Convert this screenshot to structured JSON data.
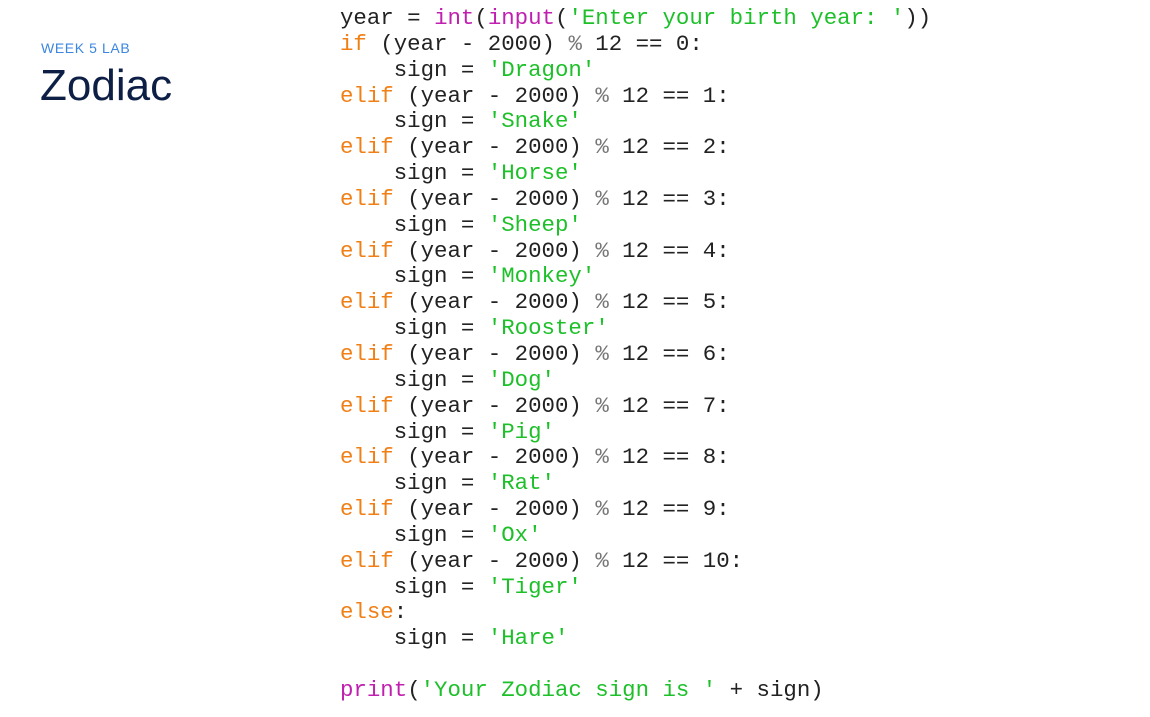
{
  "header": {
    "eyebrow": "WEEK 5 LAB",
    "title": "Zodiac"
  },
  "colors": {
    "eyebrow": "#3b86e0",
    "title": "#0d1f45",
    "keyword": "#f07f16",
    "builtin": "#c020b0",
    "string": "#1ec02a",
    "operator": "#777777",
    "text": "#222222"
  },
  "code": {
    "language": "python",
    "lines": [
      [
        {
          "t": "txt",
          "v": "year = "
        },
        {
          "t": "fn",
          "v": "int"
        },
        {
          "t": "txt",
          "v": "("
        },
        {
          "t": "fn",
          "v": "input"
        },
        {
          "t": "txt",
          "v": "("
        },
        {
          "t": "str",
          "v": "'Enter your birth year: '"
        },
        {
          "t": "txt",
          "v": "))"
        }
      ],
      [
        {
          "t": "kw",
          "v": "if"
        },
        {
          "t": "txt",
          "v": " (year - 2000) "
        },
        {
          "t": "op",
          "v": "%"
        },
        {
          "t": "txt",
          "v": " 12 == 0:"
        }
      ],
      [
        {
          "t": "txt",
          "v": "    sign = "
        },
        {
          "t": "str",
          "v": "'Dragon'"
        }
      ],
      [
        {
          "t": "kw",
          "v": "elif"
        },
        {
          "t": "txt",
          "v": " (year - 2000) "
        },
        {
          "t": "op",
          "v": "%"
        },
        {
          "t": "txt",
          "v": " 12 == 1:"
        }
      ],
      [
        {
          "t": "txt",
          "v": "    sign = "
        },
        {
          "t": "str",
          "v": "'Snake'"
        }
      ],
      [
        {
          "t": "kw",
          "v": "elif"
        },
        {
          "t": "txt",
          "v": " (year - 2000) "
        },
        {
          "t": "op",
          "v": "%"
        },
        {
          "t": "txt",
          "v": " 12 == 2:"
        }
      ],
      [
        {
          "t": "txt",
          "v": "    sign = "
        },
        {
          "t": "str",
          "v": "'Horse'"
        }
      ],
      [
        {
          "t": "kw",
          "v": "elif"
        },
        {
          "t": "txt",
          "v": " (year - 2000) "
        },
        {
          "t": "op",
          "v": "%"
        },
        {
          "t": "txt",
          "v": " 12 == 3:"
        }
      ],
      [
        {
          "t": "txt",
          "v": "    sign = "
        },
        {
          "t": "str",
          "v": "'Sheep'"
        }
      ],
      [
        {
          "t": "kw",
          "v": "elif"
        },
        {
          "t": "txt",
          "v": " (year - 2000) "
        },
        {
          "t": "op",
          "v": "%"
        },
        {
          "t": "txt",
          "v": " 12 == 4:"
        }
      ],
      [
        {
          "t": "txt",
          "v": "    sign = "
        },
        {
          "t": "str",
          "v": "'Monkey'"
        }
      ],
      [
        {
          "t": "kw",
          "v": "elif"
        },
        {
          "t": "txt",
          "v": " (year - 2000) "
        },
        {
          "t": "op",
          "v": "%"
        },
        {
          "t": "txt",
          "v": " 12 == 5:"
        }
      ],
      [
        {
          "t": "txt",
          "v": "    sign = "
        },
        {
          "t": "str",
          "v": "'Rooster'"
        }
      ],
      [
        {
          "t": "kw",
          "v": "elif"
        },
        {
          "t": "txt",
          "v": " (year - 2000) "
        },
        {
          "t": "op",
          "v": "%"
        },
        {
          "t": "txt",
          "v": " 12 == 6:"
        }
      ],
      [
        {
          "t": "txt",
          "v": "    sign = "
        },
        {
          "t": "str",
          "v": "'Dog'"
        }
      ],
      [
        {
          "t": "kw",
          "v": "elif"
        },
        {
          "t": "txt",
          "v": " (year - 2000) "
        },
        {
          "t": "op",
          "v": "%"
        },
        {
          "t": "txt",
          "v": " 12 == 7:"
        }
      ],
      [
        {
          "t": "txt",
          "v": "    sign = "
        },
        {
          "t": "str",
          "v": "'Pig'"
        }
      ],
      [
        {
          "t": "kw",
          "v": "elif"
        },
        {
          "t": "txt",
          "v": " (year - 2000) "
        },
        {
          "t": "op",
          "v": "%"
        },
        {
          "t": "txt",
          "v": " 12 == 8:"
        }
      ],
      [
        {
          "t": "txt",
          "v": "    sign = "
        },
        {
          "t": "str",
          "v": "'Rat'"
        }
      ],
      [
        {
          "t": "kw",
          "v": "elif"
        },
        {
          "t": "txt",
          "v": " (year - 2000) "
        },
        {
          "t": "op",
          "v": "%"
        },
        {
          "t": "txt",
          "v": " 12 == 9:"
        }
      ],
      [
        {
          "t": "txt",
          "v": "    sign = "
        },
        {
          "t": "str",
          "v": "'Ox'"
        }
      ],
      [
        {
          "t": "kw",
          "v": "elif"
        },
        {
          "t": "txt",
          "v": " (year - 2000) "
        },
        {
          "t": "op",
          "v": "%"
        },
        {
          "t": "txt",
          "v": " 12 == 10:"
        }
      ],
      [
        {
          "t": "txt",
          "v": "    sign = "
        },
        {
          "t": "str",
          "v": "'Tiger'"
        }
      ],
      [
        {
          "t": "kw",
          "v": "else"
        },
        {
          "t": "txt",
          "v": ":"
        }
      ],
      [
        {
          "t": "txt",
          "v": "    sign = "
        },
        {
          "t": "str",
          "v": "'Hare'"
        }
      ],
      [],
      [
        {
          "t": "fn",
          "v": "print"
        },
        {
          "t": "txt",
          "v": "("
        },
        {
          "t": "str",
          "v": "'Your Zodiac sign is '"
        },
        {
          "t": "txt",
          "v": " + sign)"
        }
      ]
    ]
  }
}
